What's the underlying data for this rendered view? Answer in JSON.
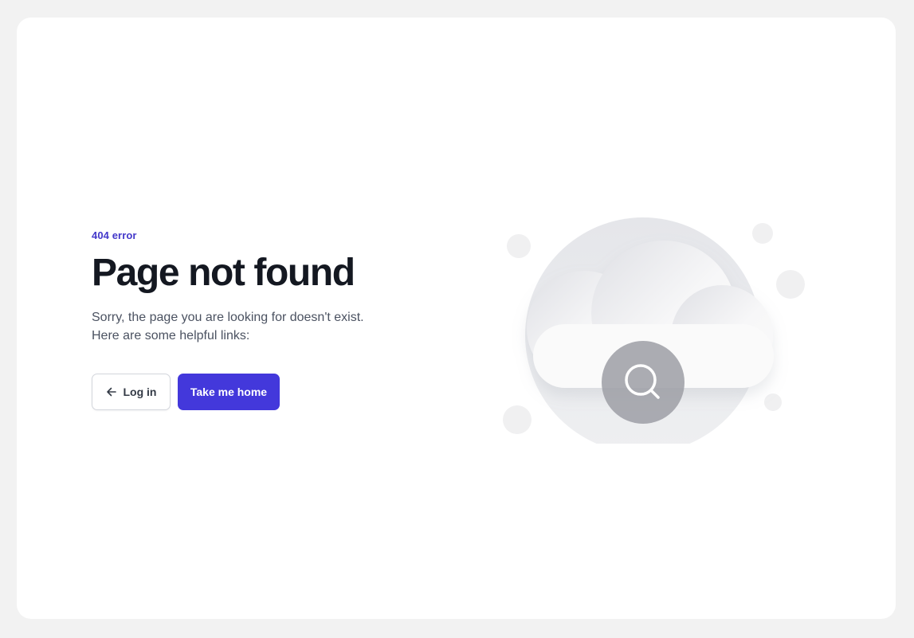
{
  "error_label": "404 error",
  "title": "Page not found",
  "description": "Sorry, the page you are looking for doesn't exist.\nHere are some helpful links:",
  "buttons": {
    "login_label": "Log in",
    "home_label": "Take me home"
  },
  "icons": {
    "back": "arrow-left-icon",
    "search": "search-icon"
  },
  "colors": {
    "accent": "#4338db",
    "heading": "#141821",
    "body_text": "#4b5261",
    "page_bg": "#f2f2f2"
  }
}
